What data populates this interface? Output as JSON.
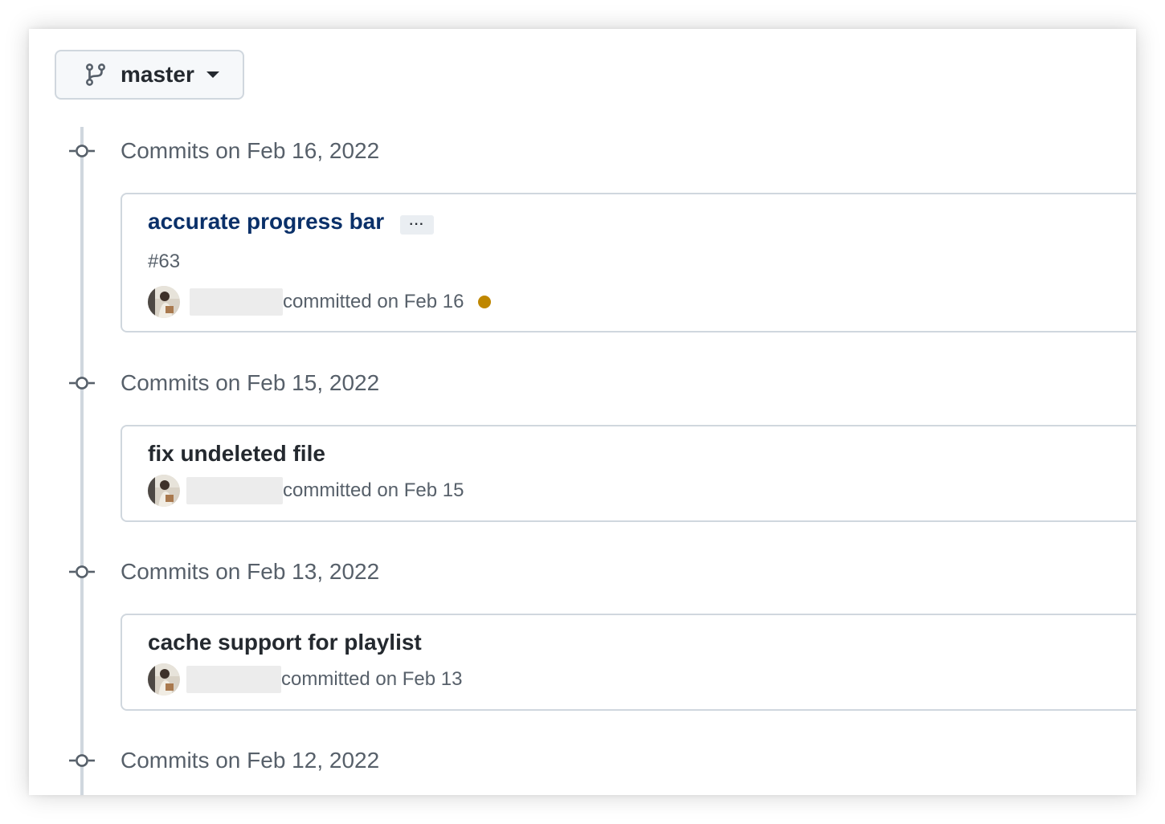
{
  "branch": {
    "name": "master",
    "icon": "git-branch-icon"
  },
  "groups": [
    {
      "title": "Commits on Feb 16, 2022",
      "commit": {
        "message": "accurate progress bar",
        "pr_ref": "#63",
        "committed_text": "committed on Feb 16",
        "status": "pending",
        "status_color": "#bf8700"
      }
    },
    {
      "title": "Commits on Feb 15, 2022",
      "commit": {
        "message": "fix undeleted file",
        "committed_text": "committed on Feb 15"
      }
    },
    {
      "title": "Commits on Feb 13, 2022",
      "commit": {
        "message": "cache support for playlist",
        "committed_text": "committed on Feb 13"
      }
    },
    {
      "title": "Commits on Feb 12, 2022"
    }
  ],
  "colors": {
    "link": "#0a3069",
    "border": "#d0d7de",
    "muted": "#57606a",
    "pending": "#bf8700"
  }
}
